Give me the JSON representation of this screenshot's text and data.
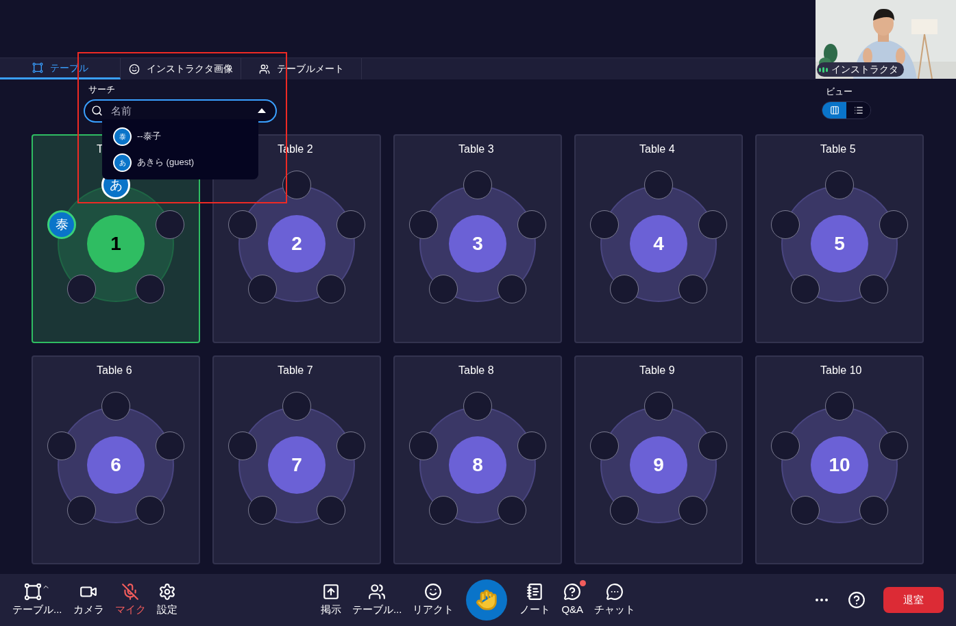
{
  "tabs": [
    {
      "kind": "table",
      "label": "テーブル",
      "selected": true
    },
    {
      "kind": "face",
      "label": "インストラクタ画像",
      "selected": false
    },
    {
      "kind": "people",
      "label": "テーブルメート",
      "selected": false
    }
  ],
  "video": {
    "kind": "picture",
    "label": "インストラクタ"
  },
  "search": {
    "label": "サーチ",
    "placeholder": "名前",
    "expanded": true
  },
  "dropdown": [
    {
      "initial": "泰",
      "name": "--泰子"
    },
    {
      "initial": "あ",
      "name": "あきら (guest)"
    }
  ],
  "view": {
    "label": "ビュー",
    "options": [
      {
        "kind": "grid",
        "selected": true
      },
      {
        "kind": "list",
        "selected": false
      }
    ]
  },
  "tables": [
    {
      "title": "T",
      "number": "1",
      "selected": true,
      "seats": [
        {
          "kind": "occupied",
          "initial": "あ",
          "highlighted": false
        },
        {
          "kind": "empty"
        },
        {
          "kind": "empty"
        },
        {
          "kind": "empty"
        },
        {
          "kind": "occupied",
          "initial": "泰",
          "highlighted": true
        }
      ]
    },
    {
      "title": "Table 2",
      "number": "2",
      "selected": false,
      "seats": [
        {
          "kind": "empty"
        },
        {
          "kind": "empty"
        },
        {
          "kind": "empty"
        },
        {
          "kind": "empty"
        },
        {
          "kind": "empty"
        }
      ]
    },
    {
      "title": "Table 3",
      "number": "3",
      "selected": false,
      "seats": [
        {
          "kind": "empty"
        },
        {
          "kind": "empty"
        },
        {
          "kind": "empty"
        },
        {
          "kind": "empty"
        },
        {
          "kind": "empty"
        }
      ]
    },
    {
      "title": "Table 4",
      "number": "4",
      "selected": false,
      "seats": [
        {
          "kind": "empty"
        },
        {
          "kind": "empty"
        },
        {
          "kind": "empty"
        },
        {
          "kind": "empty"
        },
        {
          "kind": "empty"
        }
      ]
    },
    {
      "title": "Table 5",
      "number": "5",
      "selected": false,
      "seats": [
        {
          "kind": "empty"
        },
        {
          "kind": "empty"
        },
        {
          "kind": "empty"
        },
        {
          "kind": "empty"
        },
        {
          "kind": "empty"
        }
      ]
    },
    {
      "title": "Table 6",
      "number": "6",
      "selected": false,
      "seats": [
        {
          "kind": "empty"
        },
        {
          "kind": "empty"
        },
        {
          "kind": "empty"
        },
        {
          "kind": "empty"
        },
        {
          "kind": "empty"
        }
      ]
    },
    {
      "title": "Table 7",
      "number": "7",
      "selected": false,
      "seats": [
        {
          "kind": "empty"
        },
        {
          "kind": "empty"
        },
        {
          "kind": "empty"
        },
        {
          "kind": "empty"
        },
        {
          "kind": "empty"
        }
      ]
    },
    {
      "title": "Table 8",
      "number": "8",
      "selected": false,
      "seats": [
        {
          "kind": "empty"
        },
        {
          "kind": "empty"
        },
        {
          "kind": "empty"
        },
        {
          "kind": "empty"
        },
        {
          "kind": "empty"
        }
      ]
    },
    {
      "title": "Table 9",
      "number": "9",
      "selected": false,
      "seats": [
        {
          "kind": "empty"
        },
        {
          "kind": "empty"
        },
        {
          "kind": "empty"
        },
        {
          "kind": "empty"
        },
        {
          "kind": "empty"
        }
      ]
    },
    {
      "title": "Table 10",
      "number": "10",
      "selected": false,
      "seats": [
        {
          "kind": "empty"
        },
        {
          "kind": "empty"
        },
        {
          "kind": "empty"
        },
        {
          "kind": "empty"
        },
        {
          "kind": "empty"
        }
      ]
    }
  ],
  "toolbar": {
    "left": [
      {
        "kind": "tables",
        "label": "テーブル...",
        "muted": false
      },
      {
        "kind": "camera",
        "label": "カメラ",
        "muted": false
      },
      {
        "kind": "mic",
        "label": "マイク",
        "muted": true
      },
      {
        "kind": "settings",
        "label": "設定",
        "muted": false
      }
    ],
    "center": [
      {
        "kind": "board",
        "label": "掲示",
        "badge": false
      },
      {
        "kind": "people",
        "label": "テーブル...",
        "badge": false
      },
      {
        "kind": "react",
        "label": "リアクト",
        "badge": false
      },
      {
        "kind": "hand"
      },
      {
        "kind": "note",
        "label": "ノート",
        "badge": false
      },
      {
        "kind": "qa",
        "label": "Q&A",
        "badge": true
      },
      {
        "kind": "chat",
        "label": "チャット",
        "badge": false
      }
    ],
    "leave": "退室"
  }
}
